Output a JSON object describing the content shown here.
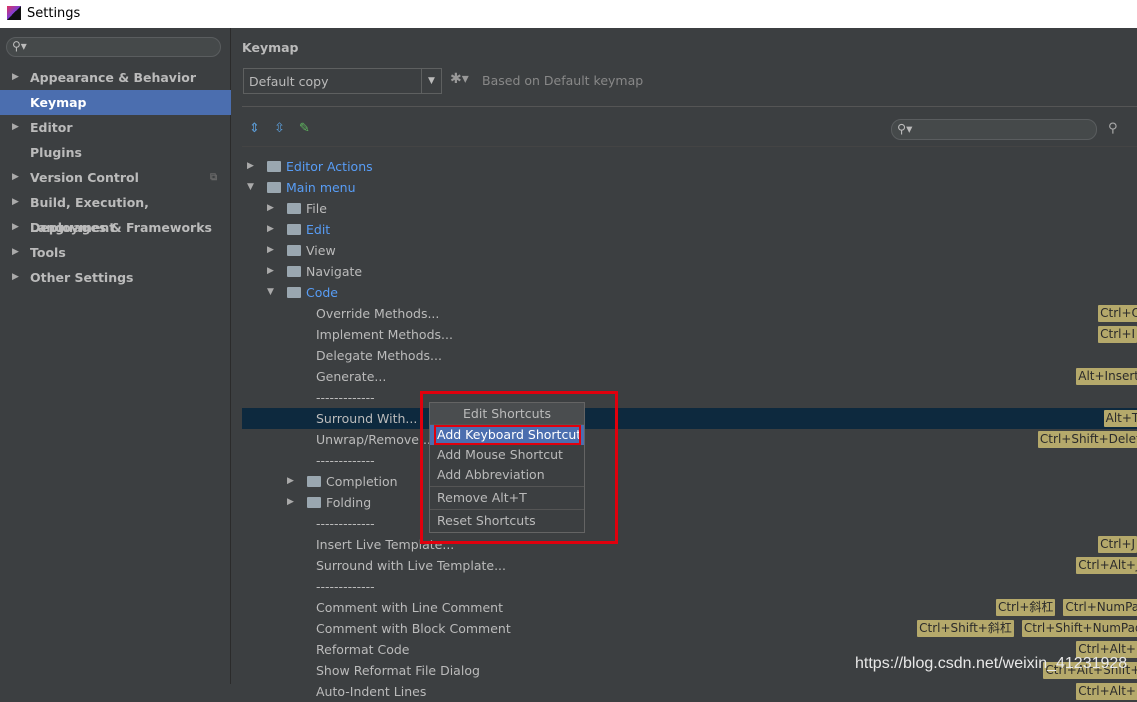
{
  "window": {
    "title": "Settings"
  },
  "sidebar": {
    "search_icon": "search-icon",
    "items": [
      {
        "label": "Appearance & Behavior",
        "expandable": true
      },
      {
        "label": "Keymap",
        "selected": true
      },
      {
        "label": "Editor",
        "expandable": true
      },
      {
        "label": "Plugins"
      },
      {
        "label": "Version Control",
        "expandable": true
      },
      {
        "label": "Build, Execution, Deployment",
        "expandable": true
      },
      {
        "label": "Languages & Frameworks",
        "expandable": true
      },
      {
        "label": "Tools",
        "expandable": true
      },
      {
        "label": "Other Settings",
        "expandable": true
      }
    ]
  },
  "main": {
    "title": "Keymap",
    "keymap_value": "Default copy",
    "based_on": "Based on Default keymap"
  },
  "tree": {
    "rows": [
      {
        "label": "Editor Actions",
        "level": 0,
        "type": "folder",
        "state": "collapsed",
        "blue": true
      },
      {
        "label": "Main menu",
        "level": 0,
        "type": "folder",
        "state": "expanded",
        "blue": true
      },
      {
        "label": "File",
        "level": 1,
        "type": "folder",
        "state": "collapsed"
      },
      {
        "label": "Edit",
        "level": 1,
        "type": "folder",
        "state": "collapsed",
        "blue": true
      },
      {
        "label": "View",
        "level": 1,
        "type": "folder",
        "state": "collapsed"
      },
      {
        "label": "Navigate",
        "level": 1,
        "type": "folder",
        "state": "collapsed"
      },
      {
        "label": "Code",
        "level": 1,
        "type": "folder",
        "state": "expanded",
        "blue": true
      },
      {
        "label": "Override Methods...",
        "level": 3,
        "shortcuts": [
          "Ctrl+O"
        ]
      },
      {
        "label": "Implement Methods...",
        "level": 3,
        "shortcuts": [
          "Ctrl+I"
        ]
      },
      {
        "label": "Delegate Methods...",
        "level": 3
      },
      {
        "label": "Generate...",
        "level": 3,
        "shortcuts": [
          "Alt+Insert"
        ]
      },
      {
        "label": "-------------",
        "level": 3
      },
      {
        "label": "Surround With...",
        "level": 3,
        "selected": true,
        "shortcuts": [
          "Alt+T"
        ]
      },
      {
        "label": "Unwrap/Remove...",
        "level": 3,
        "shortcuts": [
          "Ctrl+Shift+Delete"
        ]
      },
      {
        "label": "-------------",
        "level": 3
      },
      {
        "label": "Completion",
        "level": 2,
        "type": "folder",
        "state": "collapsed"
      },
      {
        "label": "Folding",
        "level": 2,
        "type": "folder",
        "state": "collapsed"
      },
      {
        "label": "-------------",
        "level": 3
      },
      {
        "label": "Insert Live Template...",
        "level": 3,
        "shortcuts": [
          "Ctrl+J"
        ]
      },
      {
        "label": "Surround with Live Template...",
        "level": 3,
        "shortcuts": [
          "Ctrl+Alt+J"
        ]
      },
      {
        "label": "-------------",
        "level": 3
      },
      {
        "label": "Comment with Line Comment",
        "level": 3,
        "shortcuts": [
          "Ctrl+斜杠",
          "Ctrl+NumPad /"
        ]
      },
      {
        "label": "Comment with Block Comment",
        "level": 3,
        "shortcuts": [
          "Ctrl+Shift+斜杠",
          "Ctrl+Shift+NumPad /"
        ]
      },
      {
        "label": "Reformat Code",
        "level": 3,
        "shortcuts": [
          "Ctrl+Alt+L"
        ]
      },
      {
        "label": "Show Reformat File Dialog",
        "level": 3,
        "shortcuts": [
          "Ctrl+Alt+Shift+L"
        ]
      },
      {
        "label": "Auto-Indent Lines",
        "level": 3,
        "shortcuts": [
          "Ctrl+Alt+I"
        ]
      }
    ]
  },
  "popup": {
    "title": "Edit Shortcuts",
    "items": [
      "Add Keyboard Shortcut",
      "Add Mouse Shortcut",
      "Add Abbreviation",
      "Remove Alt+T",
      "Reset Shortcuts"
    ]
  },
  "watermark": "https://blog.csdn.net/weixin_41231928",
  "colors": {
    "accent": "#4b6eaf",
    "selection": "#0d293e",
    "shortcut_badge": "#b5a96b",
    "highlight_box": "#e0000d",
    "link": "#589df6"
  }
}
